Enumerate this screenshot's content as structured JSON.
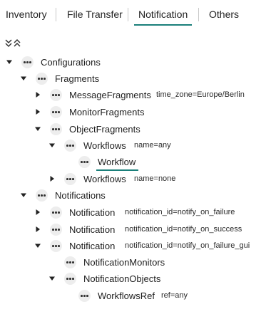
{
  "tabs": [
    "Inventory",
    "File Transfer",
    "Notification",
    "Others"
  ],
  "active_tab": "Notification",
  "accent_color": "#1a7f7a",
  "tree": {
    "rows": [
      {
        "label": "Configurations",
        "attr": "",
        "toggle": "expanded"
      },
      {
        "label": "Fragments",
        "attr": "",
        "toggle": "expanded"
      },
      {
        "label": "MessageFragments",
        "attr": "time_zone=Europe/Berlin",
        "toggle": "collapsed"
      },
      {
        "label": "MonitorFragments",
        "attr": "",
        "toggle": "collapsed"
      },
      {
        "label": "ObjectFragments",
        "attr": "",
        "toggle": "expanded"
      },
      {
        "label": "Workflows",
        "attr": "name=any",
        "toggle": "expanded"
      },
      {
        "label": "Workflow",
        "attr": "",
        "toggle": "none",
        "selected": true
      },
      {
        "label": "Workflows",
        "attr": "name=none",
        "toggle": "collapsed"
      },
      {
        "label": "Notifications",
        "attr": "",
        "toggle": "expanded"
      },
      {
        "label": "Notification",
        "attr": "notification_id=notify_on_failure",
        "toggle": "collapsed"
      },
      {
        "label": "Notification",
        "attr": "notification_id=notify_on_success",
        "toggle": "collapsed"
      },
      {
        "label": "Notification",
        "attr": "notification_id=notify_on_failure_gui",
        "toggle": "expanded"
      },
      {
        "label": "NotificationMonitors",
        "attr": "",
        "toggle": "none"
      },
      {
        "label": "NotificationObjects",
        "attr": "",
        "toggle": "expanded"
      },
      {
        "label": "WorkflowsRef",
        "attr": "ref=any",
        "toggle": "none"
      }
    ]
  }
}
